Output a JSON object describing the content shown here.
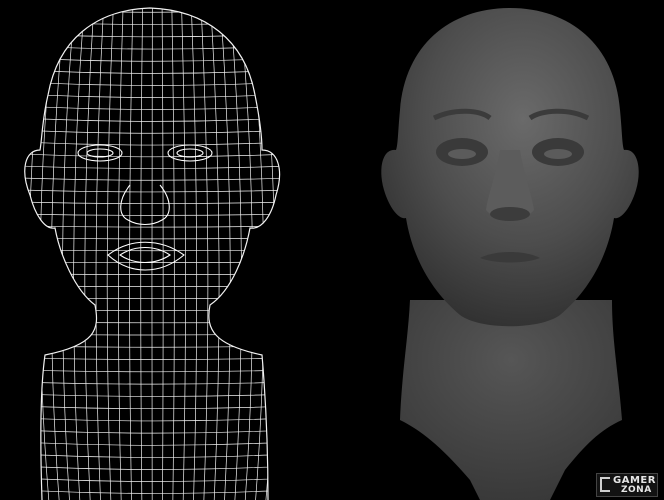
{
  "image": {
    "background_color": "#000000",
    "wire_color": "#f2f2f2",
    "sculpt_color": "#4a4a4a"
  },
  "watermark": {
    "line1": "GAMER",
    "line2": "ZONA"
  }
}
